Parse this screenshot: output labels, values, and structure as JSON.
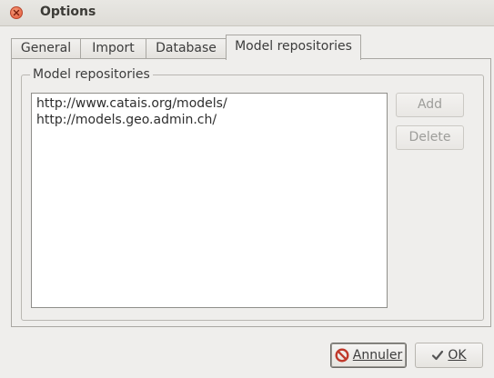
{
  "window": {
    "title": "Options"
  },
  "tabs": [
    "General",
    "Import",
    "Database",
    "Model repositories"
  ],
  "active_tab": "Model repositories",
  "group": {
    "title": "Model repositories",
    "items": [
      "http://www.catais.org/models/",
      "http://models.geo.admin.ch/"
    ],
    "add_label": "Add",
    "delete_label": "Delete"
  },
  "footer": {
    "cancel_label": "Annuler",
    "ok_label": "OK"
  },
  "colors": {
    "close_button": "#e2593b",
    "cancel_icon": "#c0392b",
    "ok_icon": "#555555"
  },
  "icons": {
    "close": "close-icon",
    "cancel": "cancel-icon",
    "ok": "checkmark-icon"
  }
}
